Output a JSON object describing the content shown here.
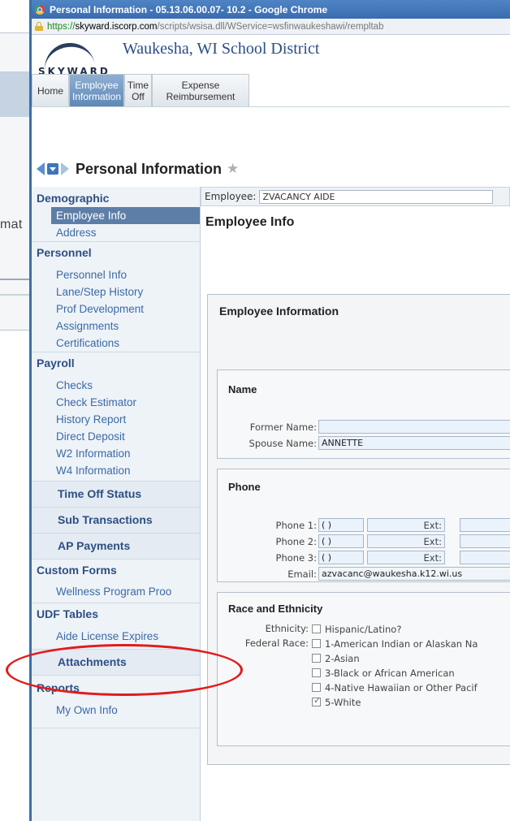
{
  "background_page": {
    "partial_text": "mat"
  },
  "window": {
    "title": "Personal Information - 05.13.06.00.07- 10.2 - Google Chrome",
    "url_https": "https://",
    "url_host": "skyward.iscorp.com",
    "url_path": "/scripts/wsisa.dll/WService=wsfinwaukeshawi/rempltab"
  },
  "header": {
    "logo_text": "SKYWARD",
    "district": "Waukesha, WI School District",
    "tabs": [
      {
        "label": "Home"
      },
      {
        "label": "Employee Information"
      },
      {
        "label": "Time Off"
      },
      {
        "label": "Expense Reimbursement"
      }
    ]
  },
  "breadcrumb": {
    "title": "Personal Information"
  },
  "sidebar": {
    "demographic": "Demographic",
    "employee_info": "Employee Info",
    "address": "Address",
    "personnel": "Personnel",
    "personnel_items": [
      "Personnel Info",
      "Lane/Step History",
      "Prof Development",
      "Assignments",
      "Certifications"
    ],
    "payroll": "Payroll",
    "payroll_items": [
      "Checks",
      "Check Estimator",
      "History Report",
      "Direct Deposit",
      "W2 Information",
      "W4 Information"
    ],
    "time_off_status": "Time Off Status",
    "sub_transactions": "Sub Transactions",
    "ap_payments": "AP Payments",
    "custom_forms": "Custom Forms",
    "wellness": "Wellness Program Proo",
    "udf_tables": "UDF Tables",
    "aide_license": "Aide License Expires",
    "attachments": "Attachments",
    "reports": "Reports",
    "my_own_info": "My Own Info"
  },
  "main": {
    "employee_label": "Employee:",
    "employee_value": "ZVACANCY AIDE",
    "page_title": "Employee Info",
    "section_title": "Employee Information",
    "name": {
      "title": "Name",
      "former_label": "Former Name:",
      "former_value": "",
      "spouse_label": "Spouse Name:",
      "spouse_value": "ANNETTE"
    },
    "phone": {
      "title": "Phone",
      "phone1_label": "Phone 1:",
      "phone2_label": "Phone 2:",
      "phone3_label": "Phone 3:",
      "area_value": "(   )",
      "ext_label": "Ext:",
      "email_label": "Email:",
      "email_value": "azvacanc@waukesha.k12.wi.us"
    },
    "race": {
      "title": "Race and Ethnicity",
      "ethnicity_label": "Ethnicity:",
      "hispanic": "Hispanic/Latino?",
      "federal_label": "Federal Race:",
      "options": [
        {
          "label": "1-American Indian or Alaskan Na",
          "checked": false
        },
        {
          "label": "2-Asian",
          "checked": false
        },
        {
          "label": "3-Black or African American",
          "checked": false
        },
        {
          "label": "4-Native Hawaiian or Other Pacif",
          "checked": false
        },
        {
          "label": "5-White",
          "checked": true
        }
      ]
    }
  },
  "colors": {
    "annotation": "#e21b1b",
    "accent": "#5d7ea7",
    "link": "#3a6aa6"
  }
}
